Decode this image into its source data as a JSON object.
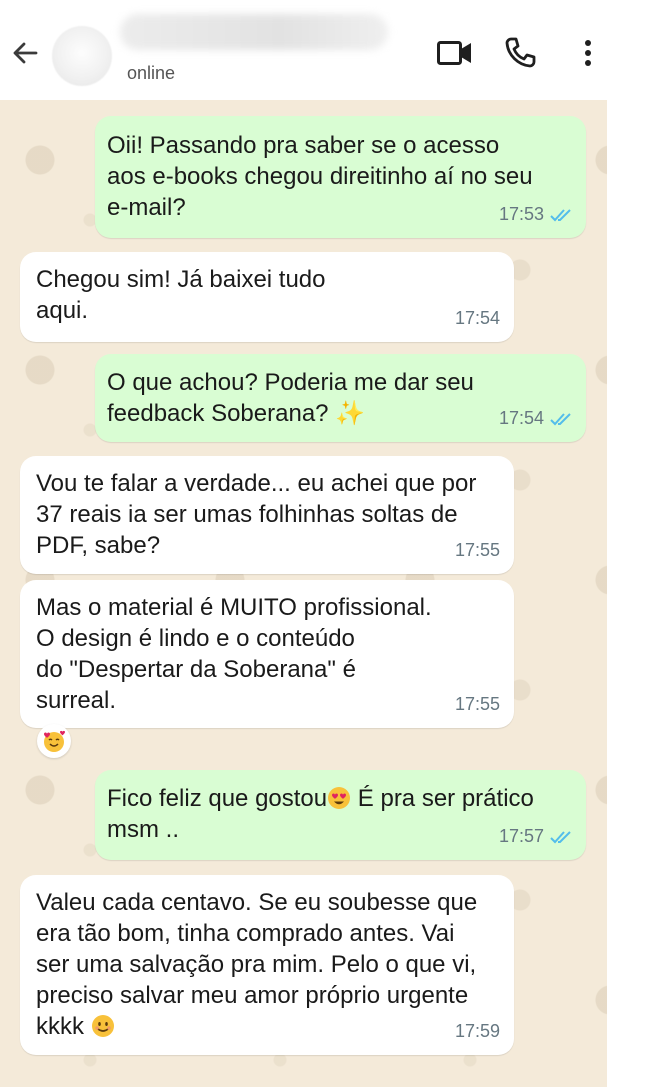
{
  "header": {
    "status": "online",
    "back_icon": "arrow-left-icon",
    "video_icon": "video-camera-icon",
    "call_icon": "phone-icon",
    "menu_icon": "more-vertical-icon"
  },
  "colors": {
    "chat_background": "#f4ead9",
    "incoming_bubble": "#ffffff",
    "outgoing_bubble": "#d9fdd3",
    "read_ticks": "#53bdeb"
  },
  "messages": [
    {
      "direction": "out",
      "text": "Oii! Passando pra saber se o acesso\naos e-books chegou direitinho aí no seu\ne-mail?",
      "time": "17:53",
      "status": "read"
    },
    {
      "direction": "in",
      "text": "Chegou sim! Já baixei tudo\naqui.",
      "time": "17:54"
    },
    {
      "direction": "out",
      "text": "O que achou? Poderia me dar seu\nfeedback Soberana?",
      "emoji": "✨",
      "time": "17:54",
      "status": "read"
    },
    {
      "direction": "in",
      "text": "Vou te falar a verdade... eu achei que por\n37 reais ia ser umas folhinhas soltas de\nPDF, sabe?",
      "time": "17:55"
    },
    {
      "direction": "in",
      "text": "Mas o material é MUITO profissional.\nO design é lindo e o conteúdo\ndo \"Despertar da Soberana\" é\nsurreal.",
      "time": "17:55",
      "reaction": "smiling-face-with-hearts"
    },
    {
      "direction": "out",
      "text_before_emoji": "Fico feliz que gostou",
      "emoji": "heart-eyes-emoji",
      "text_after_emoji": " É pra ser prático\nmsm ..",
      "time": "17:57",
      "status": "read"
    },
    {
      "direction": "in",
      "text": "Valeu cada centavo. Se eu soubesse que\nera tão bom, tinha comprado antes. Vai\nser uma salvação pra mim. Pelo o que vi,\npreciso salvar meu amor próprio urgente\nkkkk ",
      "emoji": "smiling-face-emoji",
      "time": "17:59"
    }
  ]
}
